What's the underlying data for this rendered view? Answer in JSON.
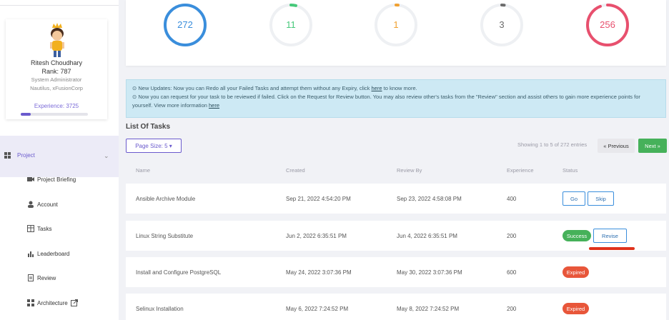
{
  "profile": {
    "name": "Ritesh Choudhary",
    "rank": "Rank: 787",
    "role": "System Administrator",
    "org": "Nautilus, xFusionCorp",
    "experience": "Experience: 3725",
    "experience_fraction": 0.15
  },
  "nav": {
    "project": "Project",
    "items": [
      "Project Briefing",
      "Account",
      "Tasks",
      "Leaderboard",
      "Review",
      "Architecture"
    ]
  },
  "stats": [
    {
      "value": "272",
      "color": "#3a8edc",
      "fraction": 1.0
    },
    {
      "value": "11",
      "color": "#46c97a",
      "fraction": 0.04
    },
    {
      "value": "1",
      "color": "#f0a030",
      "fraction": 0.01
    },
    {
      "value": "3",
      "color": "#6c6c6c",
      "fraction": 0.02
    },
    {
      "value": "256",
      "color": "#e8506e",
      "fraction": 0.94
    }
  ],
  "notice": {
    "line1_pre": "⊙ New Updates: Now you can Redo all your Failed Tasks and attempt them without any Expiry, click",
    "line1_link": "here",
    "line1_post": "to know more.",
    "line2_pre": "⊙ Now you can request for your task to be reviewed if failed. Click on the Request for Review button. You may also review other's tasks from the \"Review\" section and assist others to gain more experience points for yourself. View more information",
    "line2_link": "here"
  },
  "list": {
    "title": "List Of Tasks",
    "page_size": "Page Size: 5 ▾",
    "showing": "Showing 1 to 5 of 272 entries",
    "prev": "« Previous",
    "next": "Next »"
  },
  "columns": [
    "Name",
    "Created",
    "Review By",
    "Experience",
    "Status"
  ],
  "rows": [
    {
      "name": "Ansible Archive Module",
      "created": "Sep 21, 2022 4:54:20 PM",
      "review_by": "Sep 23, 2022 4:58:08 PM",
      "experience": "400"
    },
    {
      "name": "Linux String Substitute",
      "created": "Jun 2, 2022 6:35:51 PM",
      "review_by": "Jun 4, 2022 6:35:51 PM",
      "experience": "200"
    },
    {
      "name": "Install and Configure PostgreSQL",
      "created": "May 24, 2022 3:07:36 PM",
      "review_by": "May 30, 2022 3:07:36 PM",
      "experience": "600"
    },
    {
      "name": "Selinux Installation",
      "created": "May 6, 2022 7:24:52 PM",
      "review_by": "May 8, 2022 7:24:52 PM",
      "experience": "200"
    }
  ],
  "actions": {
    "go": "Go",
    "skip": "Skip",
    "success": "Success",
    "revise": "Revise",
    "expired": "Expired"
  },
  "colors": {
    "accent": "#6a5acd",
    "success": "#46b15a",
    "expired": "#e8563a"
  }
}
